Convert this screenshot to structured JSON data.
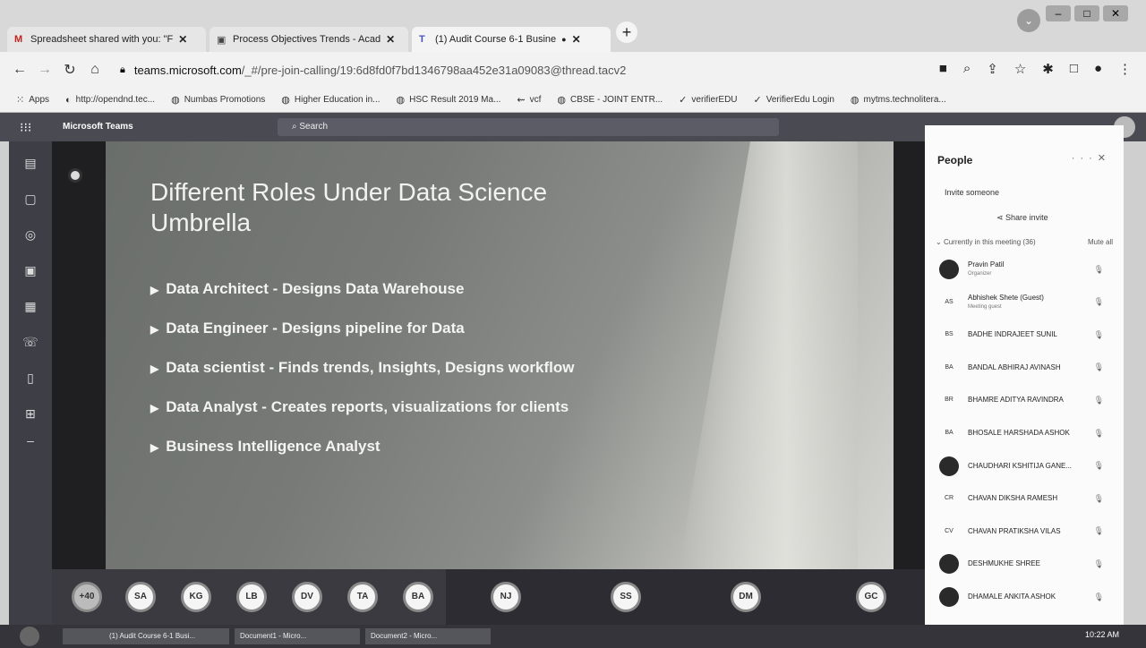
{
  "browser": {
    "tabs": [
      {
        "title": "Spreadsheet shared with you: \"F",
        "favicon_color": "#c5221f",
        "favicon": "M"
      },
      {
        "title": "Process Objectives Trends - Acad",
        "favicon_color": "#444",
        "favicon": "▣"
      },
      {
        "title": "(1) Audit Course 6-1 Busine",
        "favicon_color": "#4b53bc",
        "favicon": "T"
      }
    ],
    "new_tab": "+",
    "url_host": "teams.microsoft.com",
    "url_path": "/_#/pre-join-calling/19:6d8fd0f7bd1346798aa452e31a09083@thread.tacv2",
    "bookmarks": [
      {
        "label": "Apps",
        "icon": "apps-icon"
      },
      {
        "label": "http://opendnd.tec...",
        "icon": "globe-icon"
      },
      {
        "label": "Numbas Promotions",
        "icon": "globe-icon"
      },
      {
        "label": "Higher Education in...",
        "icon": "globe-icon"
      },
      {
        "label": "HSC Result 2019 Ma...",
        "icon": "globe-icon"
      },
      {
        "label": "vcf",
        "icon": "link-icon"
      },
      {
        "label": "CBSE - JOINT ENTR...",
        "icon": "globe-icon"
      },
      {
        "label": "verifierEDU",
        "icon": "check-icon"
      },
      {
        "label": "VerifierEdu Login",
        "icon": "check-icon"
      },
      {
        "label": "mytms.technoliterа...",
        "icon": "globe-icon"
      }
    ]
  },
  "teams": {
    "brand": "Microsoft Teams",
    "search_placeholder": "Search"
  },
  "slide": {
    "title": "Different Roles Under Data Science Umbrella",
    "bullets": [
      "Data Architect - Designs Data Warehouse",
      "Data Engineer - Designs pipeline for Data",
      "Data scientist - Finds trends, Insights, Designs workflow",
      "Data Analyst - Creates reports, visualizations for clients",
      "Business Intelligence Analyst"
    ]
  },
  "participants_bar": [
    "+40",
    "SA",
    "KG",
    "LB",
    "DV",
    "TA",
    "BA",
    "NJ",
    "SS",
    "DM",
    "GC"
  ],
  "people_panel": {
    "title": "People",
    "invite_placeholder": "Invite someone",
    "share_invite": "Share invite",
    "section_label": "Currently in this meeting (36)",
    "mute_all": "Mute all",
    "people": [
      {
        "initials": "",
        "name": "Pravin Patil",
        "role": "Organizer",
        "dark": true
      },
      {
        "initials": "AS",
        "name": "Abhishek Shete (Guest)",
        "role": "Meeting guest",
        "dark": false
      },
      {
        "initials": "BS",
        "name": "BADHE INDRAJEET SUNIL",
        "role": "",
        "dark": false
      },
      {
        "initials": "BA",
        "name": "BANDAL ABHIRAJ AVINASH",
        "role": "",
        "dark": false
      },
      {
        "initials": "BR",
        "name": "BHAMRE ADITYA RAVINDRA",
        "role": "",
        "dark": false
      },
      {
        "initials": "BA",
        "name": "BHOSALE HARSHADA ASHOK",
        "role": "",
        "dark": false
      },
      {
        "initials": "",
        "name": "CHAUDHARI KSHITIJA GANE...",
        "role": "",
        "dark": true
      },
      {
        "initials": "CR",
        "name": "CHAVAN DIKSHA RAMESH",
        "role": "",
        "dark": false
      },
      {
        "initials": "CV",
        "name": "CHAVAN PRATIKSHA VILAS",
        "role": "",
        "dark": false
      },
      {
        "initials": "",
        "name": "DESHMUKHE SHREE",
        "role": "",
        "dark": true
      },
      {
        "initials": "",
        "name": "DHAMALE ANKITA ASHOK",
        "role": "",
        "dark": true
      }
    ]
  },
  "taskbar": {
    "items": [
      "(1) Audit Course 6-1 Busi...",
      "Document1 - Micro...",
      "Document2 - Micro..."
    ],
    "clock": "10:22 AM"
  }
}
